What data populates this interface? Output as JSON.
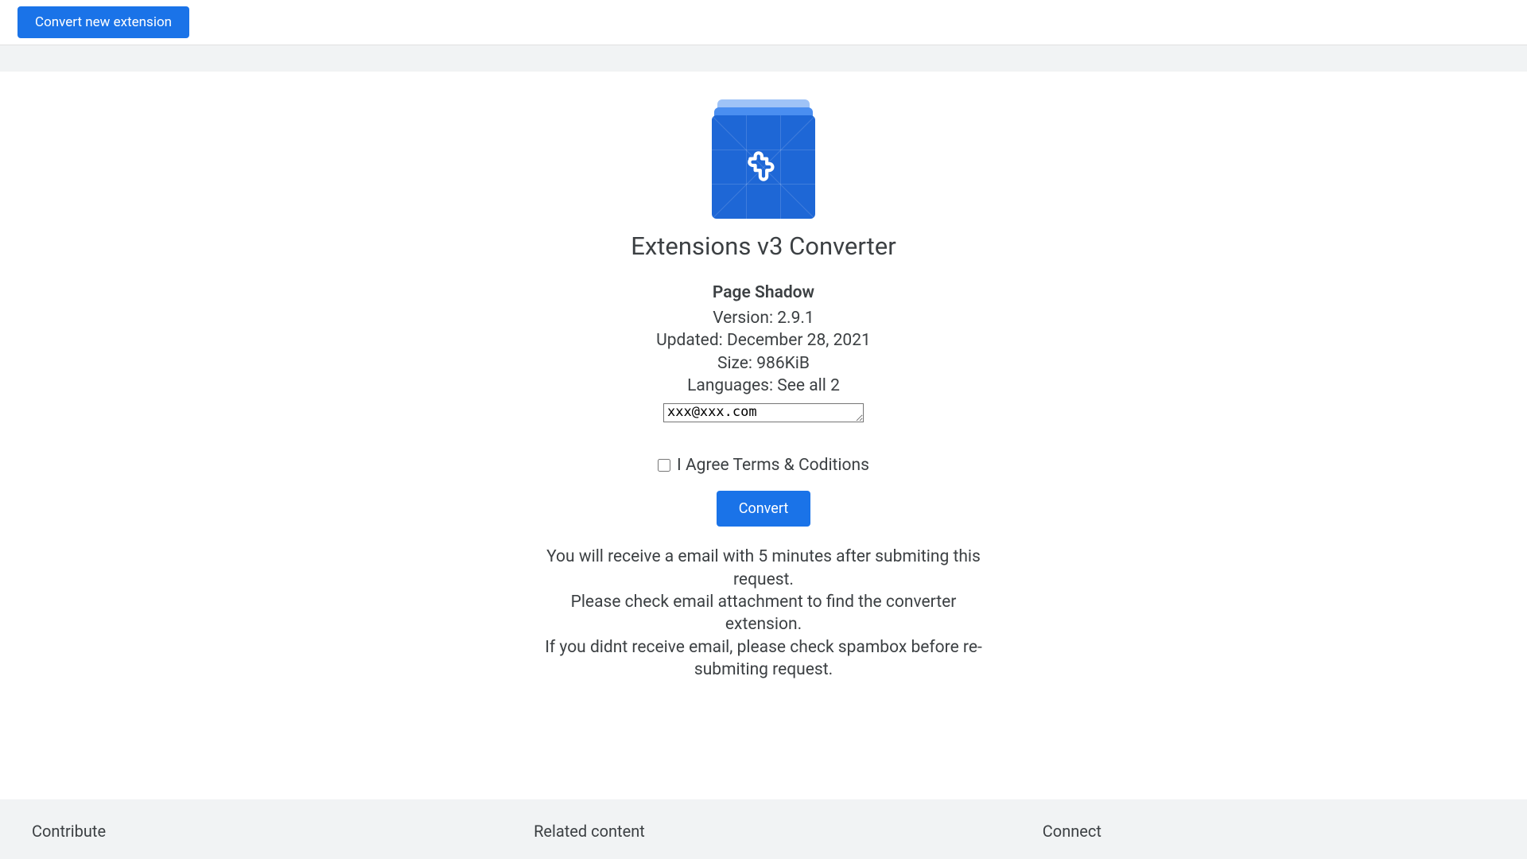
{
  "topbar": {
    "convert_new_label": "Convert new extension"
  },
  "app": {
    "title": "Extensions v3 Converter"
  },
  "extension": {
    "name": "Page Shadow",
    "version_line": "Version: 2.9.1",
    "updated_line": "Updated: December 28, 2021",
    "size_line": "Size: 986KiB",
    "languages_line": "Languages: See all 2"
  },
  "form": {
    "email_value": "xxx@xxx.com",
    "agree_label": "I Agree Terms & Coditions",
    "convert_label": "Convert"
  },
  "note": {
    "line1": "You will receive a email with 5 minutes after submiting this request.",
    "line2": "Please check email attachment to find the converter extension.",
    "line3": "If you didnt receive email, please check spambox before re-submiting request."
  },
  "footer": {
    "col1": "Contribute",
    "col2": "Related content",
    "col3": "Connect"
  }
}
